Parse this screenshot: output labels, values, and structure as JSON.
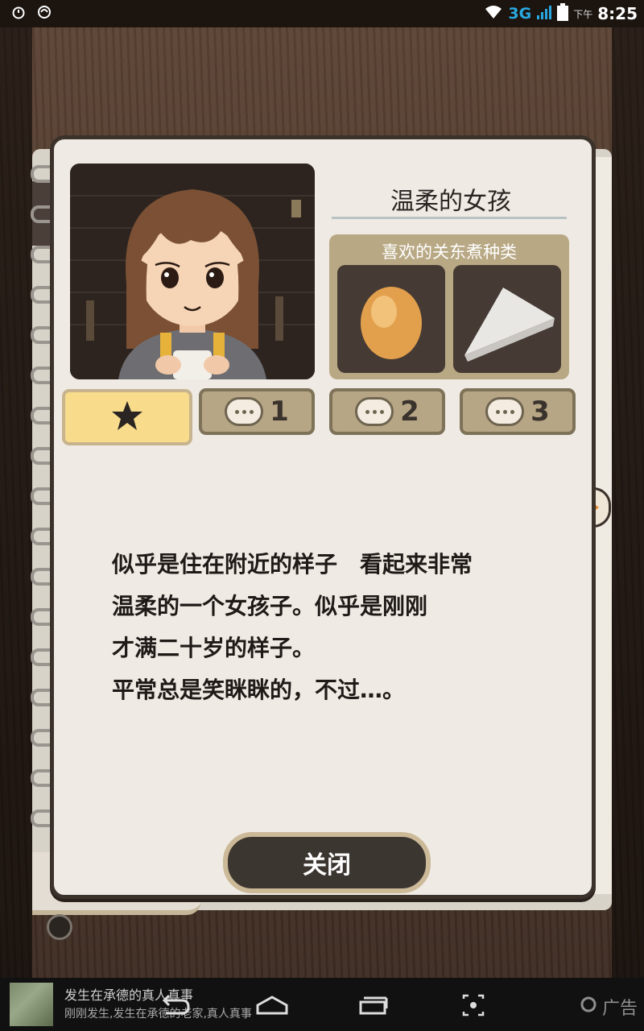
{
  "status_bar": {
    "network": "3G",
    "ampm": "下午",
    "time": "8:25"
  },
  "card": {
    "character_name": "温柔的女孩",
    "likes_title": "喜欢的关东煮种类",
    "foods": [
      "egg-icon",
      "daikon-icon"
    ],
    "tabs": [
      {
        "label": "",
        "icon": "star-icon",
        "active": true
      },
      {
        "label": "1",
        "icon": "chat-bubble-icon",
        "active": false
      },
      {
        "label": "2",
        "icon": "chat-bubble-icon",
        "active": false
      },
      {
        "label": "3",
        "icon": "chat-bubble-icon",
        "active": false
      }
    ],
    "description_lines": [
      "似乎是住在附近的样子　看起来非常",
      "温柔的一个女孩子。似乎是刚刚",
      "才满二十岁的样子。",
      "平常总是笑眯眯的，不过…。"
    ],
    "close_label": "关闭"
  },
  "ad": {
    "title": "发生在承德的真人真事",
    "subtitle": "刚刚发生,发生在承德的老家,真人真事",
    "label": "广告"
  },
  "colors": {
    "card_bg": "#efebe4",
    "card_border": "#3b322b",
    "likes_bg": "#b8a884",
    "active_tab": "#f8dc8c",
    "close_button": "#3c3631"
  }
}
